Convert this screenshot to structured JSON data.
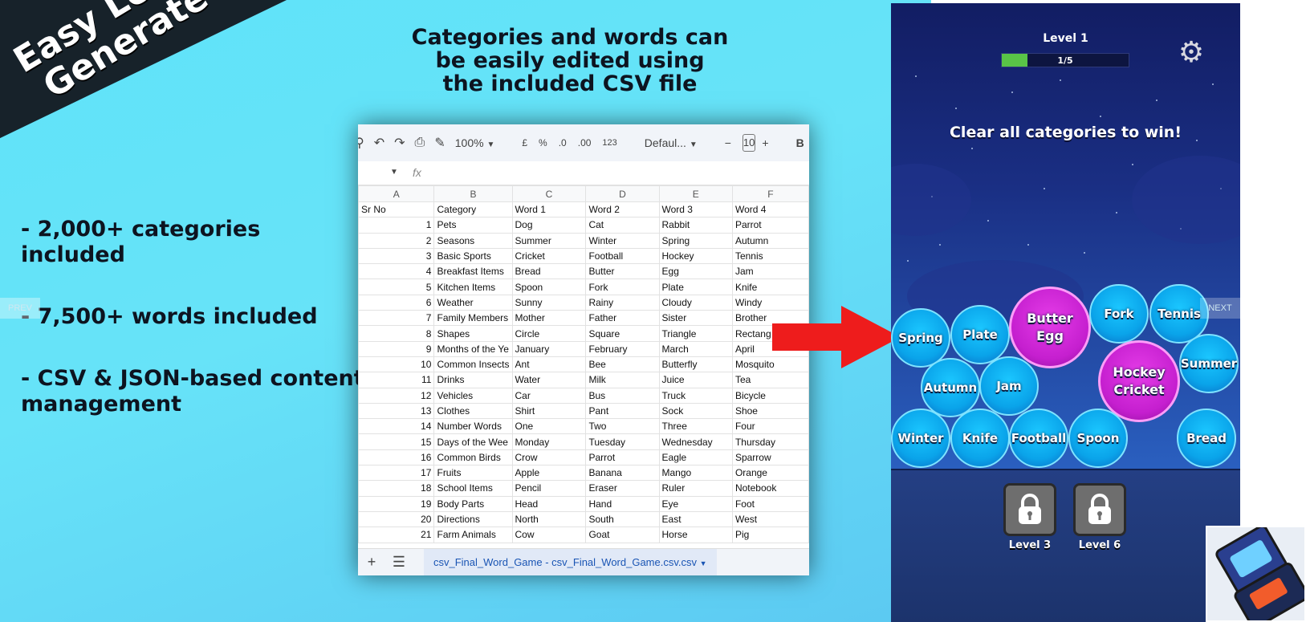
{
  "banner": {
    "line1": "Easy Level",
    "line2": "Generate"
  },
  "headline": {
    "line1": "Categories and words can",
    "line2": "be easily edited using",
    "line3": "the included CSV file"
  },
  "features": [
    "- 2,000+ categories included",
    "- 7,500+ words included",
    "- CSV & JSON-based content management"
  ],
  "nav": {
    "prev": "PREV",
    "next": "NEXT"
  },
  "spreadsheet": {
    "zoom": "100%",
    "currency": "£",
    "percent": "%",
    "decimal_less": ".0",
    "decimal_more": ".00",
    "format_number": "123",
    "font": "Defaul...",
    "font_size": "10",
    "columns": [
      "A",
      "B",
      "C",
      "D",
      "E",
      "F"
    ],
    "header_row": [
      "Sr No",
      "Category",
      "Word 1",
      "Word 2",
      "Word 3",
      "Word 4"
    ],
    "rows": [
      [
        "1",
        "Pets",
        "Dog",
        "Cat",
        "Rabbit",
        "Parrot"
      ],
      [
        "2",
        "Seasons",
        "Summer",
        "Winter",
        "Spring",
        "Autumn"
      ],
      [
        "3",
        "Basic Sports",
        "Cricket",
        "Football",
        "Hockey",
        "Tennis"
      ],
      [
        "4",
        "Breakfast Items",
        "Bread",
        "Butter",
        "Egg",
        "Jam"
      ],
      [
        "5",
        "Kitchen Items",
        "Spoon",
        "Fork",
        "Plate",
        "Knife"
      ],
      [
        "6",
        "Weather",
        "Sunny",
        "Rainy",
        "Cloudy",
        "Windy"
      ],
      [
        "7",
        "Family Members",
        "Mother",
        "Father",
        "Sister",
        "Brother"
      ],
      [
        "8",
        "Shapes",
        "Circle",
        "Square",
        "Triangle",
        "Rectang"
      ],
      [
        "9",
        "Months of the Ye",
        "January",
        "February",
        "March",
        "April"
      ],
      [
        "10",
        "Common Insects",
        "Ant",
        "Bee",
        "Butterfly",
        "Mosquito"
      ],
      [
        "11",
        "Drinks",
        "Water",
        "Milk",
        "Juice",
        "Tea"
      ],
      [
        "12",
        "Vehicles",
        "Car",
        "Bus",
        "Truck",
        "Bicycle"
      ],
      [
        "13",
        "Clothes",
        "Shirt",
        "Pant",
        "Sock",
        "Shoe"
      ],
      [
        "14",
        "Number Words",
        "One",
        "Two",
        "Three",
        "Four"
      ],
      [
        "15",
        "Days of the Wee",
        "Monday",
        "Tuesday",
        "Wednesday",
        "Thursday"
      ],
      [
        "16",
        "Common Birds",
        "Crow",
        "Parrot",
        "Eagle",
        "Sparrow"
      ],
      [
        "17",
        "Fruits",
        "Apple",
        "Banana",
        "Mango",
        "Orange"
      ],
      [
        "18",
        "School Items",
        "Pencil",
        "Eraser",
        "Ruler",
        "Notebook"
      ],
      [
        "19",
        "Body Parts",
        "Head",
        "Hand",
        "Eye",
        "Foot"
      ],
      [
        "20",
        "Directions",
        "North",
        "South",
        "East",
        "West"
      ],
      [
        "21",
        "Farm Animals",
        "Cow",
        "Goat",
        "Horse",
        "Pig"
      ]
    ],
    "sheet_tab": "csv_Final_Word_Game - csv_Final_Word_Game.csv.csv"
  },
  "game": {
    "level_title": "Level 1",
    "progress_text": "1/5",
    "progress_fraction": 0.2,
    "instruction": "Clear all categories to win!",
    "bubbles": [
      {
        "label": "Spring",
        "color": "blue"
      },
      {
        "label": "Plate",
        "color": "blue"
      },
      {
        "label": "Butter Egg",
        "line1": "Butter",
        "line2": "Egg",
        "color": "pink"
      },
      {
        "label": "Fork",
        "color": "blue"
      },
      {
        "label": "Tennis",
        "color": "blue"
      },
      {
        "label": "Autumn",
        "color": "blue"
      },
      {
        "label": "Jam",
        "color": "blue"
      },
      {
        "label": "Hockey Cricket",
        "line1": "Hockey",
        "line2": "Cricket",
        "color": "pink"
      },
      {
        "label": "Summer",
        "color": "blue"
      },
      {
        "label": "Winter",
        "color": "blue"
      },
      {
        "label": "Knife",
        "color": "blue"
      },
      {
        "label": "Football",
        "color": "blue"
      },
      {
        "label": "Spoon",
        "color": "blue"
      },
      {
        "label": "Bread",
        "color": "blue"
      }
    ],
    "locked_levels": [
      "Level 3",
      "Level 6"
    ],
    "colors": {
      "blue_bubble": "#0aa4ea",
      "pink_bubble": "#c51fcf",
      "progress_fill": "#59c447"
    }
  }
}
